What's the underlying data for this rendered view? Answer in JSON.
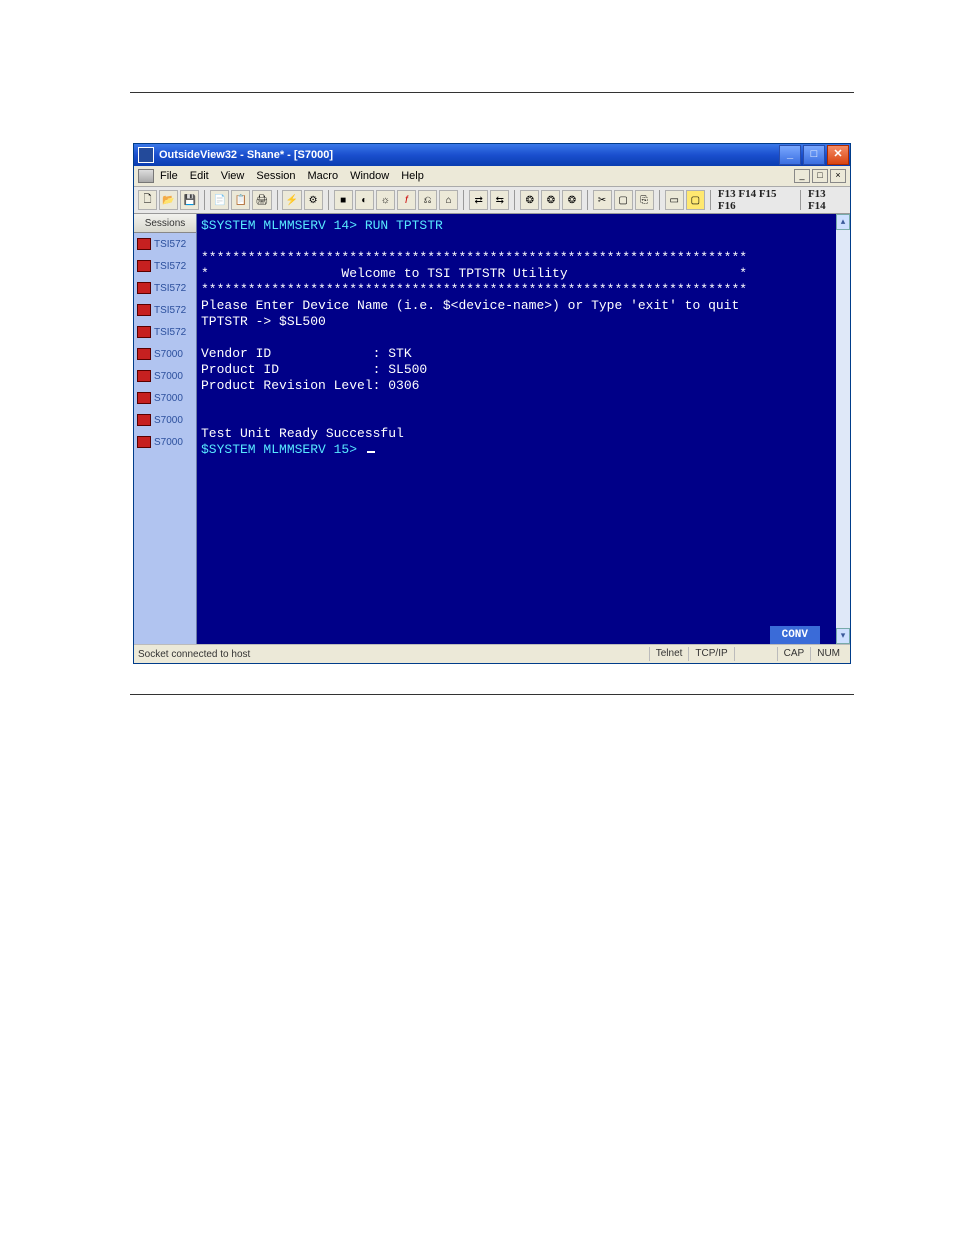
{
  "window": {
    "title": "OutsideView32 - Shane* - [S7000]"
  },
  "menubar": {
    "items": [
      "File",
      "Edit",
      "View",
      "Session",
      "Macro",
      "Window",
      "Help"
    ]
  },
  "toolbar": {
    "fkeys_left": "F13 F14 F15 F16",
    "fkeys_right": "F13 F14"
  },
  "sidebar": {
    "tab_label": "Sessions",
    "items": [
      {
        "label": "TSI572"
      },
      {
        "label": "TSI572"
      },
      {
        "label": "TSI572"
      },
      {
        "label": "TSI572"
      },
      {
        "label": "TSI572"
      },
      {
        "label": "S7000"
      },
      {
        "label": "S7000"
      },
      {
        "label": "S7000"
      },
      {
        "label": "S7000"
      },
      {
        "label": "S7000"
      }
    ]
  },
  "terminal": {
    "lines": [
      "$SYSTEM MLMMSERV 14> RUN TPTSTR",
      "",
      "**********************************************************************",
      "*                 Welcome to TSI TPTSTR Utility                      *",
      "**********************************************************************",
      "Please Enter Device Name (i.e. $<device-name>) or Type 'exit' to quit",
      "TPTSTR -> $SL500",
      "",
      "Vendor ID             : STK",
      "Product ID            : SL500",
      "Product Revision Level: 0306",
      "",
      "",
      "Test Unit Ready Successful",
      "$SYSTEM MLMMSERV 15> "
    ],
    "status": "CONV"
  },
  "statusbar": {
    "message": "Socket connected to host",
    "protocol": "Telnet",
    "transport": "TCP/IP",
    "caps": "CAP",
    "num": "NUM"
  }
}
